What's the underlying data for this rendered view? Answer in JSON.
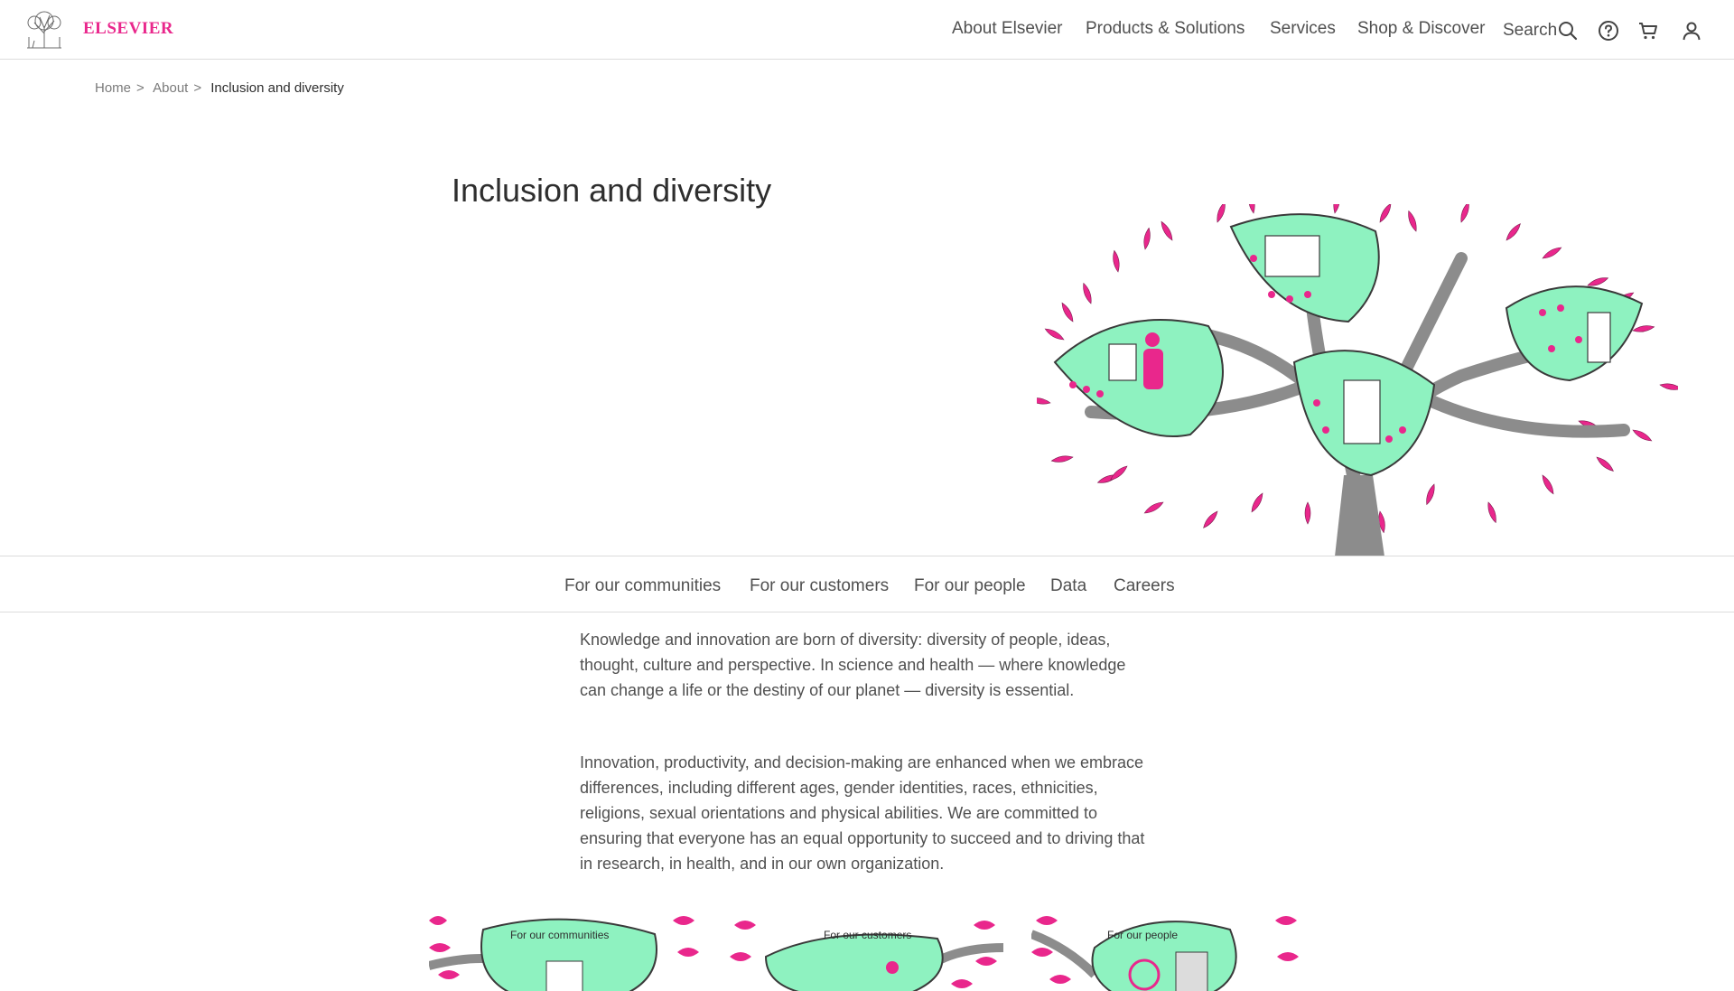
{
  "header": {
    "brand": "ELSEVIER",
    "nav": [
      "About Elsevier",
      "Products & Solutions",
      "Services",
      "Shop & Discover"
    ],
    "search_label": "Search",
    "icons": [
      "search-icon",
      "help-icon",
      "cart-icon",
      "user-icon"
    ]
  },
  "breadcrumb": {
    "items": [
      "Home",
      "About",
      "Inclusion and diversity"
    ],
    "separator": ">"
  },
  "hero": {
    "title": "Inclusion and diversity"
  },
  "subnav": {
    "items": [
      "For our communities",
      "For our customers",
      "For our people",
      "Data",
      "Careers"
    ]
  },
  "body": {
    "paragraphs": [
      "Knowledge and innovation are born of diversity: diversity of people, ideas, thought, culture and perspective. In science and health — where knowledge can change a life or the destiny of our planet — diversity is essential.",
      "Innovation, productivity, and decision-making are enhanced when we embrace differences, including different ages, gender identities, races, ethnicities, religions, sexual orientations and physical abilities. We are committed to ensuring that everyone has an equal opportunity to succeed and to driving that in research, in health, and in our own organization."
    ]
  },
  "cards": [
    {
      "label": "For our communities"
    },
    {
      "label": "For our customers"
    },
    {
      "label": "For our people"
    }
  ],
  "colors": {
    "brand": "#e9278c",
    "leaf": "#8ef2c0",
    "branch": "#8c8c8c",
    "text": "#505050"
  }
}
